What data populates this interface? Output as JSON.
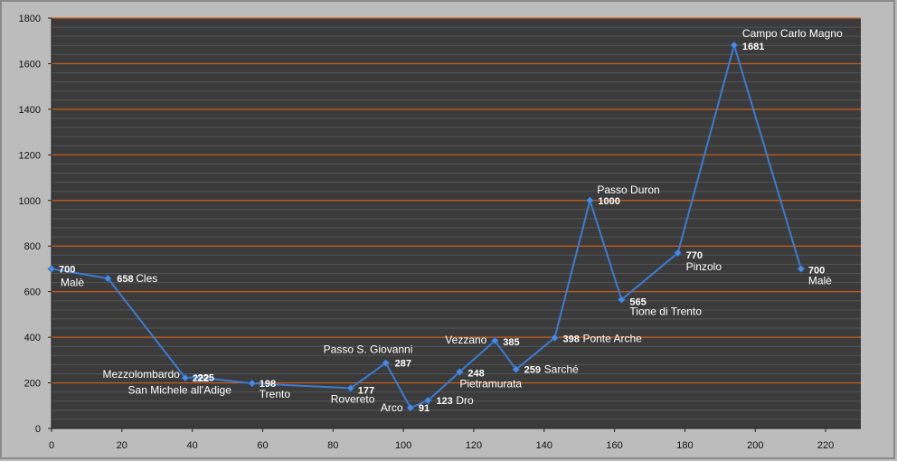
{
  "chart_data": {
    "type": "line",
    "title": "",
    "xlabel": "",
    "ylabel": "",
    "xlim": [
      0,
      230
    ],
    "ylim": [
      0,
      1800
    ],
    "x_ticks": [
      0,
      20,
      40,
      60,
      80,
      100,
      120,
      140,
      160,
      180,
      200,
      220
    ],
    "y_ticks": [
      0,
      200,
      400,
      600,
      800,
      1000,
      1200,
      1400,
      1600,
      1800
    ],
    "grid": true,
    "legend": "none",
    "colors": {
      "outer_background": "#bcbcbc",
      "plot_background": "#3b3b3b",
      "major_grid": "#d0601a",
      "minor_grid": "#555555",
      "line": "#3c7bd1",
      "marker": "#4a8ae0",
      "label_text": "#ffffff",
      "tick_text": "#111111"
    },
    "series": [
      {
        "points": [
          {
            "x": 0,
            "y": 700,
            "value": "700",
            "name": "Malè"
          },
          {
            "x": 16,
            "y": 658,
            "value": "658",
            "name": "Cles"
          },
          {
            "x": 38,
            "y": 222,
            "value": "222",
            "name": "Mezzolombardo"
          },
          {
            "x": 41,
            "y": 225,
            "value": "225",
            "name": "San Michele all'Adige"
          },
          {
            "x": 57,
            "y": 198,
            "value": "198",
            "name": "Trento"
          },
          {
            "x": 85,
            "y": 177,
            "value": "177",
            "name": "Rovereto"
          },
          {
            "x": 95,
            "y": 287,
            "value": "287",
            "name": "Passo S. Giovanni"
          },
          {
            "x": 102,
            "y": 91,
            "value": "91",
            "name": "Arco"
          },
          {
            "x": 107,
            "y": 123,
            "value": "123",
            "name": "Dro"
          },
          {
            "x": 116,
            "y": 248,
            "value": "248",
            "name": "Pietramurata"
          },
          {
            "x": 126,
            "y": 385,
            "value": "385",
            "name": "Vezzano"
          },
          {
            "x": 132,
            "y": 259,
            "value": "259",
            "name": "Sarché"
          },
          {
            "x": 143,
            "y": 398,
            "value": "398",
            "name": "Ponte Arche"
          },
          {
            "x": 153,
            "y": 1000,
            "value": "1000",
            "name": "Passo Duron"
          },
          {
            "x": 162,
            "y": 565,
            "value": "565",
            "name": "Tione di Trento"
          },
          {
            "x": 178,
            "y": 770,
            "value": "770",
            "name": "Pinzolo"
          },
          {
            "x": 194,
            "y": 1681,
            "value": "1681",
            "name": "Campo Carlo Magno"
          },
          {
            "x": 213,
            "y": 700,
            "value": "700",
            "name": "Malè"
          }
        ]
      }
    ]
  }
}
